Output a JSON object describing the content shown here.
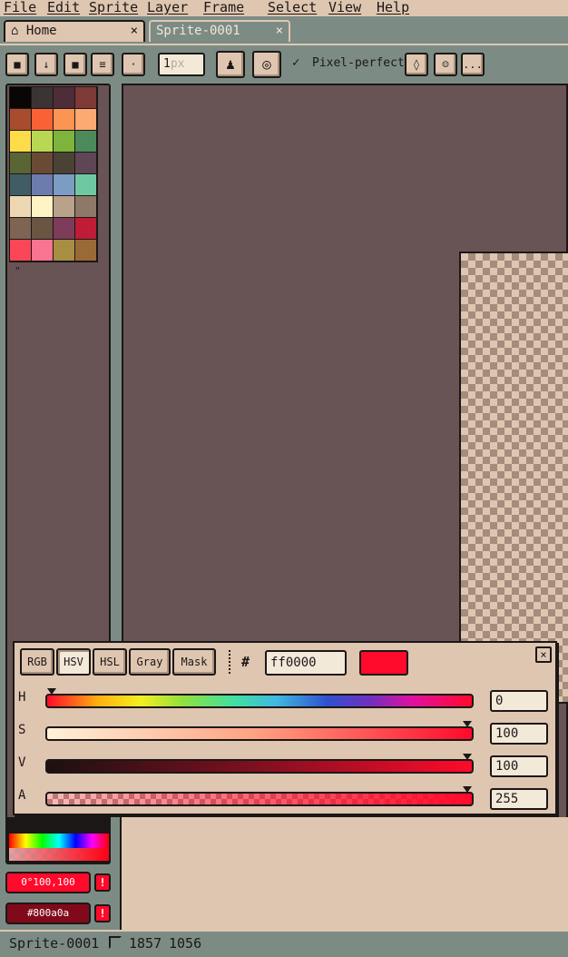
{
  "menu": {
    "items": [
      "File",
      "Edit",
      "Sprite",
      "Layer",
      "Frame",
      "Select",
      "View",
      "Help"
    ]
  },
  "tabs": [
    {
      "label": "Home",
      "icon": "home-icon",
      "close": "×"
    },
    {
      "label": "Sprite-0001",
      "close": "×"
    }
  ],
  "toolbar": {
    "brush_size_value": "1",
    "brush_size_unit": "px",
    "pixel_perfect_label": "Pixel-perfect",
    "pixel_perfect_check": "✓",
    "more_label": "...",
    "buttons": [
      {
        "name": "lock-icon",
        "glyph": "■"
      },
      {
        "name": "arrow-down-icon",
        "glyph": "↓"
      },
      {
        "name": "square-icon",
        "glyph": "■"
      },
      {
        "name": "menu-lines-icon",
        "glyph": "≡"
      },
      {
        "name": "dot-icon",
        "glyph": "·"
      },
      {
        "name": "ink-icon",
        "glyph": "♟"
      },
      {
        "name": "target-icon",
        "glyph": "◎"
      },
      {
        "name": "symmetry-icon",
        "glyph": "◊"
      },
      {
        "name": "face-icon",
        "glyph": "☺"
      }
    ]
  },
  "palette": {
    "colors": [
      "#0a0606",
      "#3a3434",
      "#4e2c38",
      "#7e3a36",
      "#a84c2e",
      "#fa6236",
      "#fc9454",
      "#fdaa72",
      "#fcdc48",
      "#b8d854",
      "#7eb43c",
      "#4c8a5c",
      "#5a6434",
      "#6a4a34",
      "#4a4234",
      "#5e4654",
      "#405c64",
      "#6c7cac",
      "#7c9cc4",
      "#70c8a2",
      "#eed8b4",
      "#fef4c4",
      "#b8a28a",
      "#8e7868",
      "#7e6452",
      "#6a5442",
      "#7c3c5a",
      "#c01c38",
      "#fb4658",
      "#f87490",
      "#a88e42",
      "#9a6a36"
    ],
    "resize_glyph": "\""
  },
  "color_popup": {
    "modes": [
      "RGB",
      "HSV",
      "HSL",
      "Gray",
      "Mask"
    ],
    "active_mode": "HSV",
    "hash": "#",
    "hex_value": "ff0000",
    "preview_color": "#ff0a2a",
    "close_glyph": "×",
    "sliders": [
      {
        "label": "H",
        "value": "0",
        "fraction": 0
      },
      {
        "label": "S",
        "value": "100",
        "fraction": 1
      },
      {
        "label": "V",
        "value": "100",
        "fraction": 1
      },
      {
        "label": "A",
        "value": "255",
        "fraction": 1
      }
    ]
  },
  "colors": {
    "foreground_label": "0°100,100",
    "foreground_color": "#ff0a2a",
    "background_label": "#800a0a",
    "background_color": "#800a1a",
    "warning_glyph": "!"
  },
  "status": {
    "document": "Sprite-0001",
    "width": "1857",
    "height": "1056"
  }
}
